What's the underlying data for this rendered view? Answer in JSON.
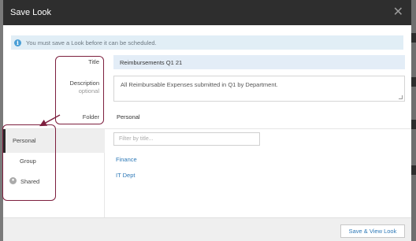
{
  "modal": {
    "title": "Save Look",
    "close_symbol": "✕"
  },
  "info": {
    "icon": "info-icon",
    "message": "You must save a Look before it can be scheduled."
  },
  "form": {
    "title_label": "Title",
    "title_value": "Reimbursements Q1 21",
    "description_label": "Description",
    "description_sublabel": "optional",
    "description_value": "All Reimbursable Expenses submitted in Q1 by Department.",
    "folder_label": "Folder",
    "folder_value": "Personal"
  },
  "folder_tabs": [
    {
      "label": "Personal",
      "selected": true
    },
    {
      "label": "Group",
      "selected": false
    },
    {
      "label": "Shared",
      "selected": false
    }
  ],
  "filter": {
    "placeholder": "Filter by title..."
  },
  "folders": [
    "Finance",
    "IT Dept"
  ],
  "footer": {
    "save_button": "Save & View Look"
  },
  "annotations": {
    "color": "#7d1f3e"
  }
}
